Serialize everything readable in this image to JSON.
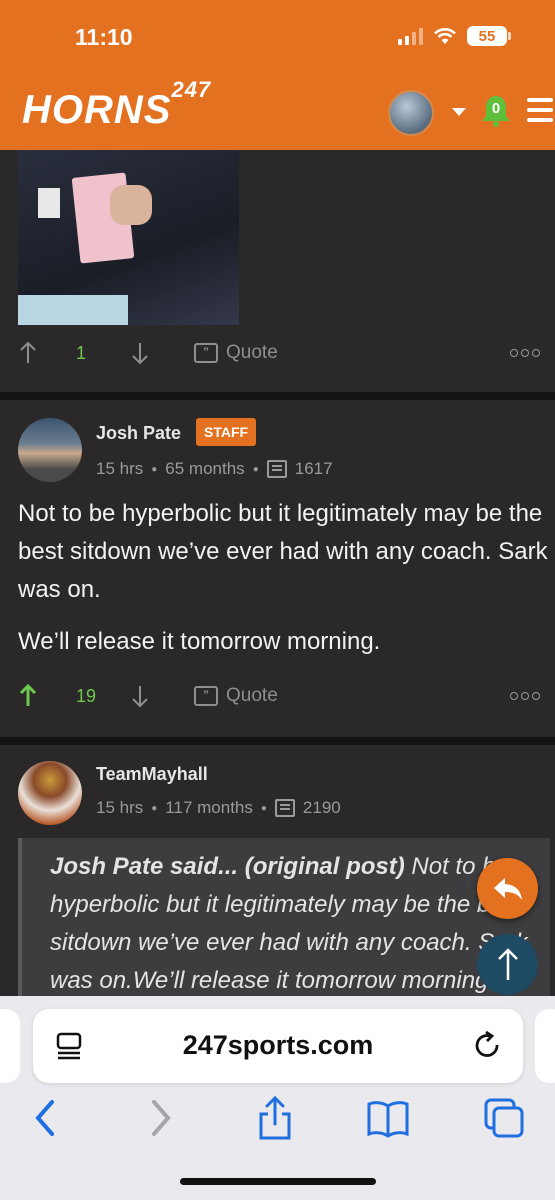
{
  "status_bar": {
    "time": "11:10",
    "battery": "55"
  },
  "header": {
    "logo_main": "HORNS",
    "logo_sup": "247",
    "notification_count": "0"
  },
  "posts": [
    {
      "vote_count": "1",
      "quote_label": "Quote"
    },
    {
      "author": "Josh Pate",
      "badge": "STAFF",
      "time": "15 hrs",
      "tenure": "65 months",
      "post_count": "1617",
      "paragraphs": [
        "Not to be hyperbolic but it legitimately may be the best sitdown we’ve ever had with any coach. Sark was on.",
        "We’ll release it tomorrow morning."
      ],
      "vote_count": "19",
      "quote_label": "Quote"
    },
    {
      "author": "TeamMayhall",
      "time": "15 hrs",
      "tenure": "117 months",
      "post_count": "2190",
      "quoted_author": "Josh Pate said... (original post)",
      "quoted_text": " Not to be hyperbolic but it legitimately may be the best sitdown we’ve ever had with any coach. Sark was on.We’ll release it tomorrow morning."
    }
  ],
  "browser": {
    "url": "247sports.com"
  },
  "colors": {
    "brand": "#e3711f",
    "upvote": "#6fc84e",
    "background": "#232323"
  }
}
